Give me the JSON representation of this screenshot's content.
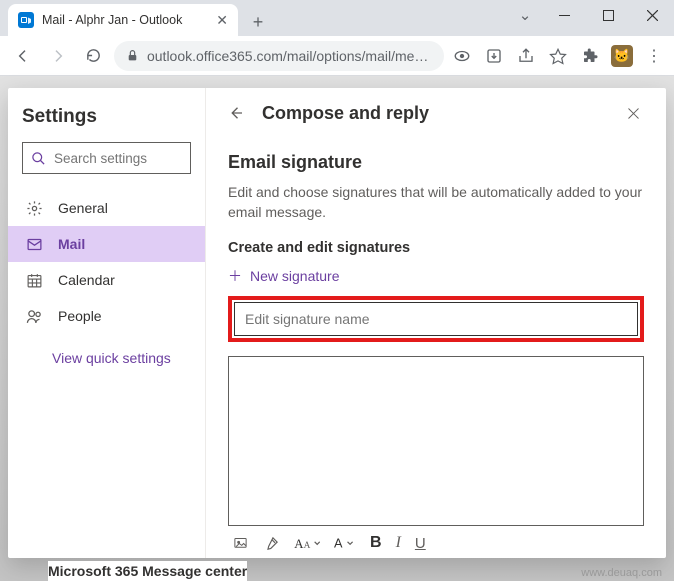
{
  "browser": {
    "tab_title": "Mail - Alphr Jan - Outlook",
    "url": "outlook.office365.com/mail/options/mail/mes…"
  },
  "sidebar": {
    "title": "Settings",
    "search_placeholder": "Search settings",
    "items": [
      {
        "label": "General"
      },
      {
        "label": "Mail"
      },
      {
        "label": "Calendar"
      },
      {
        "label": "People"
      }
    ],
    "quick_link": "View quick settings"
  },
  "main": {
    "title": "Compose and reply",
    "section_heading": "Email signature",
    "description": "Edit and choose signatures that will be automatically added to your email message.",
    "subheading": "Create and edit signatures",
    "new_signature_label": "New signature",
    "signature_name_placeholder": "Edit signature name"
  },
  "footer_peek": "Microsoft 365 Message center",
  "watermark": "www.deuaq.com"
}
